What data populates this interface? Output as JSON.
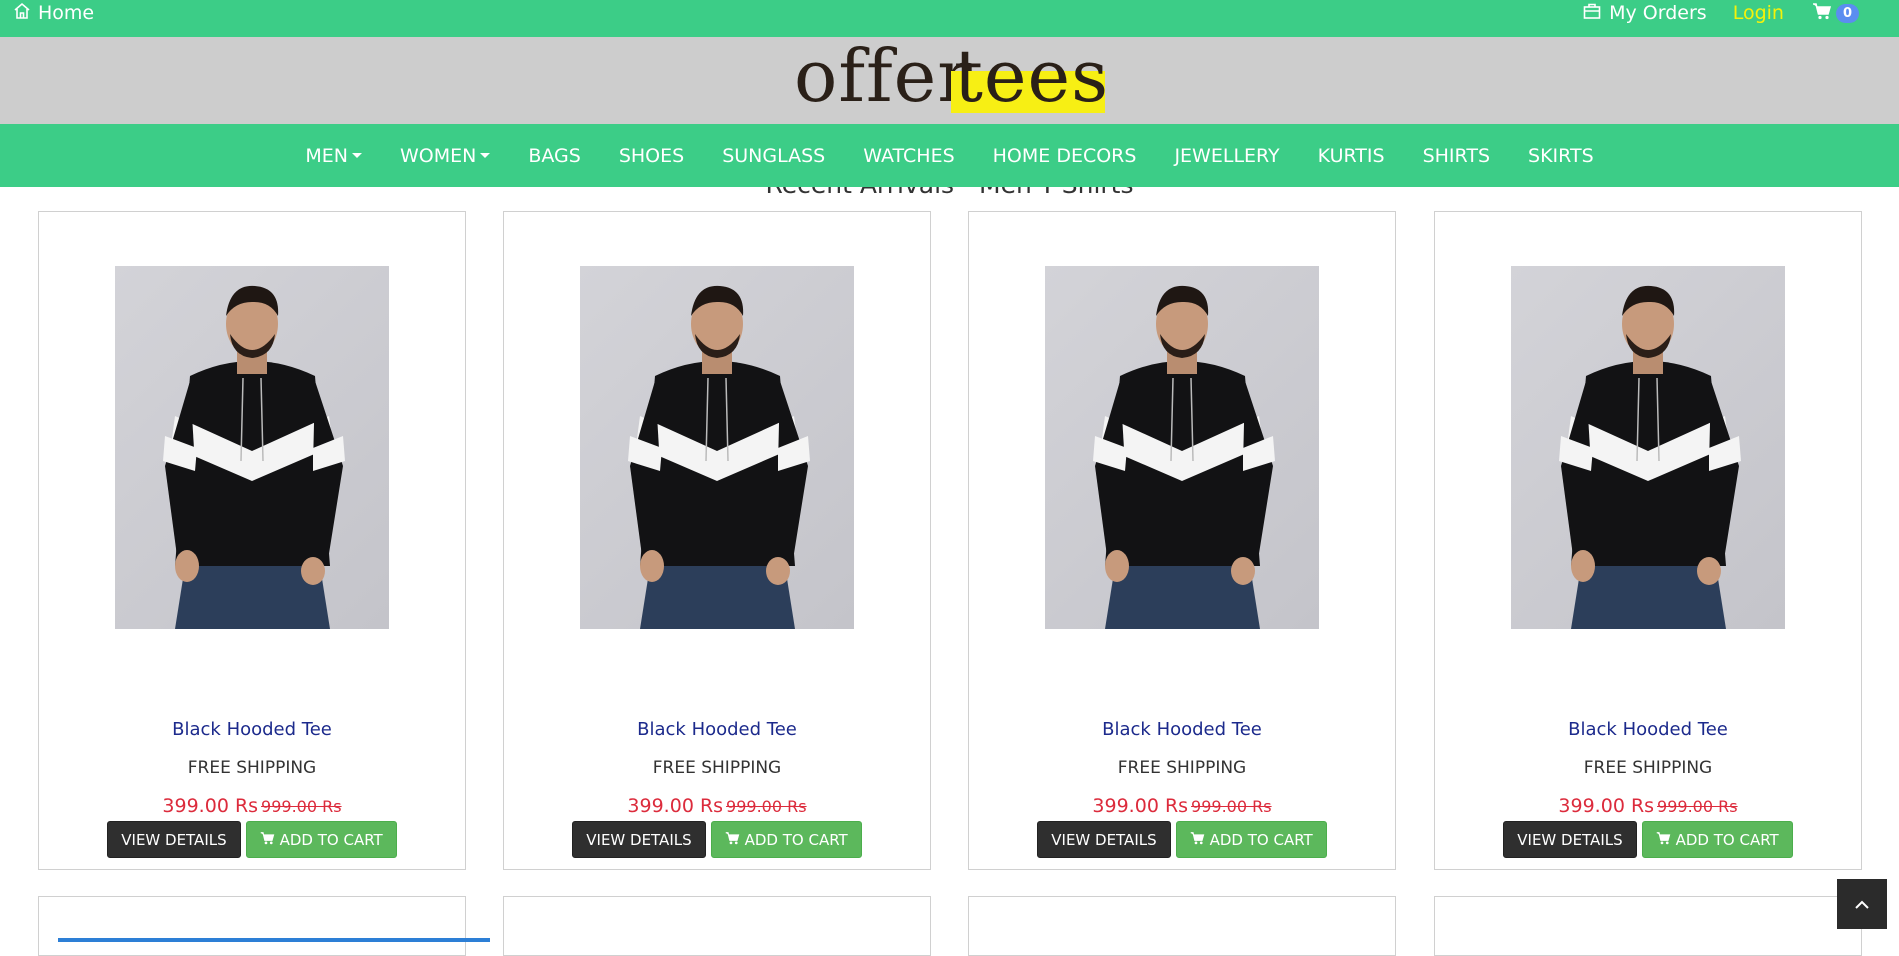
{
  "topbar": {
    "home_label": "Home",
    "orders_label": "My Orders",
    "login_label": "Login",
    "cart_count": "0"
  },
  "logo": {
    "part1": "offer",
    "part2": "tees"
  },
  "nav": {
    "items": [
      "MEN",
      "WOMEN",
      "BAGS",
      "SHOES",
      "SUNGLASS",
      "WATCHES",
      "HOME DECORS",
      "JEWELLERY",
      "KURTIS",
      "SHIRTS",
      "SKIRTS"
    ],
    "dropdown_items": [
      "MEN",
      "WOMEN"
    ]
  },
  "section_title": "Recent Arrivals - Men T-Shirts",
  "products": [
    {
      "name": "Black Hooded Tee",
      "shipping": "FREE SHIPPING",
      "price": "399.00 Rs",
      "old_price": "999.00 Rs",
      "view_label": "VIEW DETAILS",
      "cart_label": "ADD TO CART"
    },
    {
      "name": "Black Hooded Tee",
      "shipping": "FREE SHIPPING",
      "price": "399.00 Rs",
      "old_price": "999.00 Rs",
      "view_label": "VIEW DETAILS",
      "cart_label": "ADD TO CART"
    },
    {
      "name": "Black Hooded Tee",
      "shipping": "FREE SHIPPING",
      "price": "399.00 Rs",
      "old_price": "999.00 Rs",
      "view_label": "VIEW DETAILS",
      "cart_label": "ADD TO CART"
    },
    {
      "name": "Black Hooded Tee",
      "shipping": "FREE SHIPPING",
      "price": "399.00 Rs",
      "old_price": "999.00 Rs",
      "view_label": "VIEW DETAILS",
      "cart_label": "ADD TO CART"
    }
  ],
  "colors": {
    "brand_green": "#3ccd87",
    "logo_band": "#cdcdcd",
    "price_red": "#dc2b3c",
    "name_blue": "#1c2a8c",
    "logo_highlight": "#f7ef14"
  }
}
